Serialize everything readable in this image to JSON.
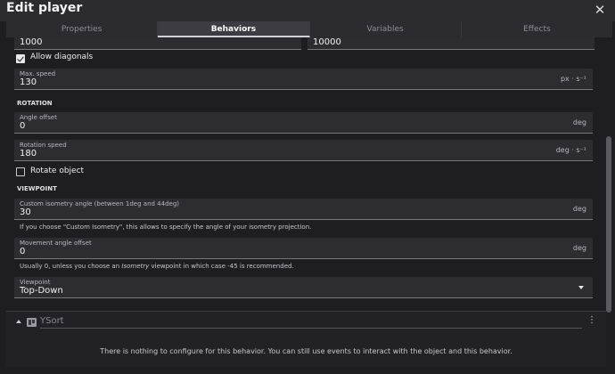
{
  "window": {
    "title": "Edit player",
    "close_icon": "close-icon"
  },
  "tabs": [
    {
      "label": "Properties"
    },
    {
      "label": "Behaviors",
      "active": true
    },
    {
      "label": "Variables"
    },
    {
      "label": "Effects"
    }
  ],
  "behavior": {
    "top_fields": {
      "left_value": "1000",
      "right_value": "10000"
    },
    "allow_diagonals": {
      "label": "Allow diagonals",
      "checked": true
    },
    "max_speed": {
      "label": "Max. speed",
      "value": "130",
      "unit": "px · s⁻¹"
    },
    "rotation_section": "ROTATION",
    "angle_offset": {
      "label": "Angle offset",
      "value": "0",
      "unit": "deg"
    },
    "rotation_speed": {
      "label": "Rotation speed",
      "value": "180",
      "unit": "deg · s⁻¹"
    },
    "rotate_object": {
      "label": "Rotate object",
      "checked": false
    },
    "viewpoint_section": "VIEWPOINT",
    "isometry_angle": {
      "label": "Custom isometry angle (between 1deg and 44deg)",
      "value": "30",
      "unit": "deg",
      "help": "If you choose \"Custom Isometry\", this allows to specify the angle of your isometry projection."
    },
    "movement_angle_offset": {
      "label": "Movement angle offset",
      "value": "0",
      "unit": "deg",
      "help_before": "Usually 0, unless you choose an ",
      "help_em": "Isometry",
      "help_after": " viewpoint in which case -45 is recommended."
    },
    "viewpoint": {
      "label": "Viewpoint",
      "value": "Top-Down"
    }
  },
  "ysort": {
    "name": "YSort",
    "info": "There is nothing to configure for this behavior. You can still use events to interact with the object and this behavior."
  },
  "colors": {
    "background": "#1e1e22",
    "field": "#2c2c31",
    "active_tab": "#3c3c42"
  }
}
